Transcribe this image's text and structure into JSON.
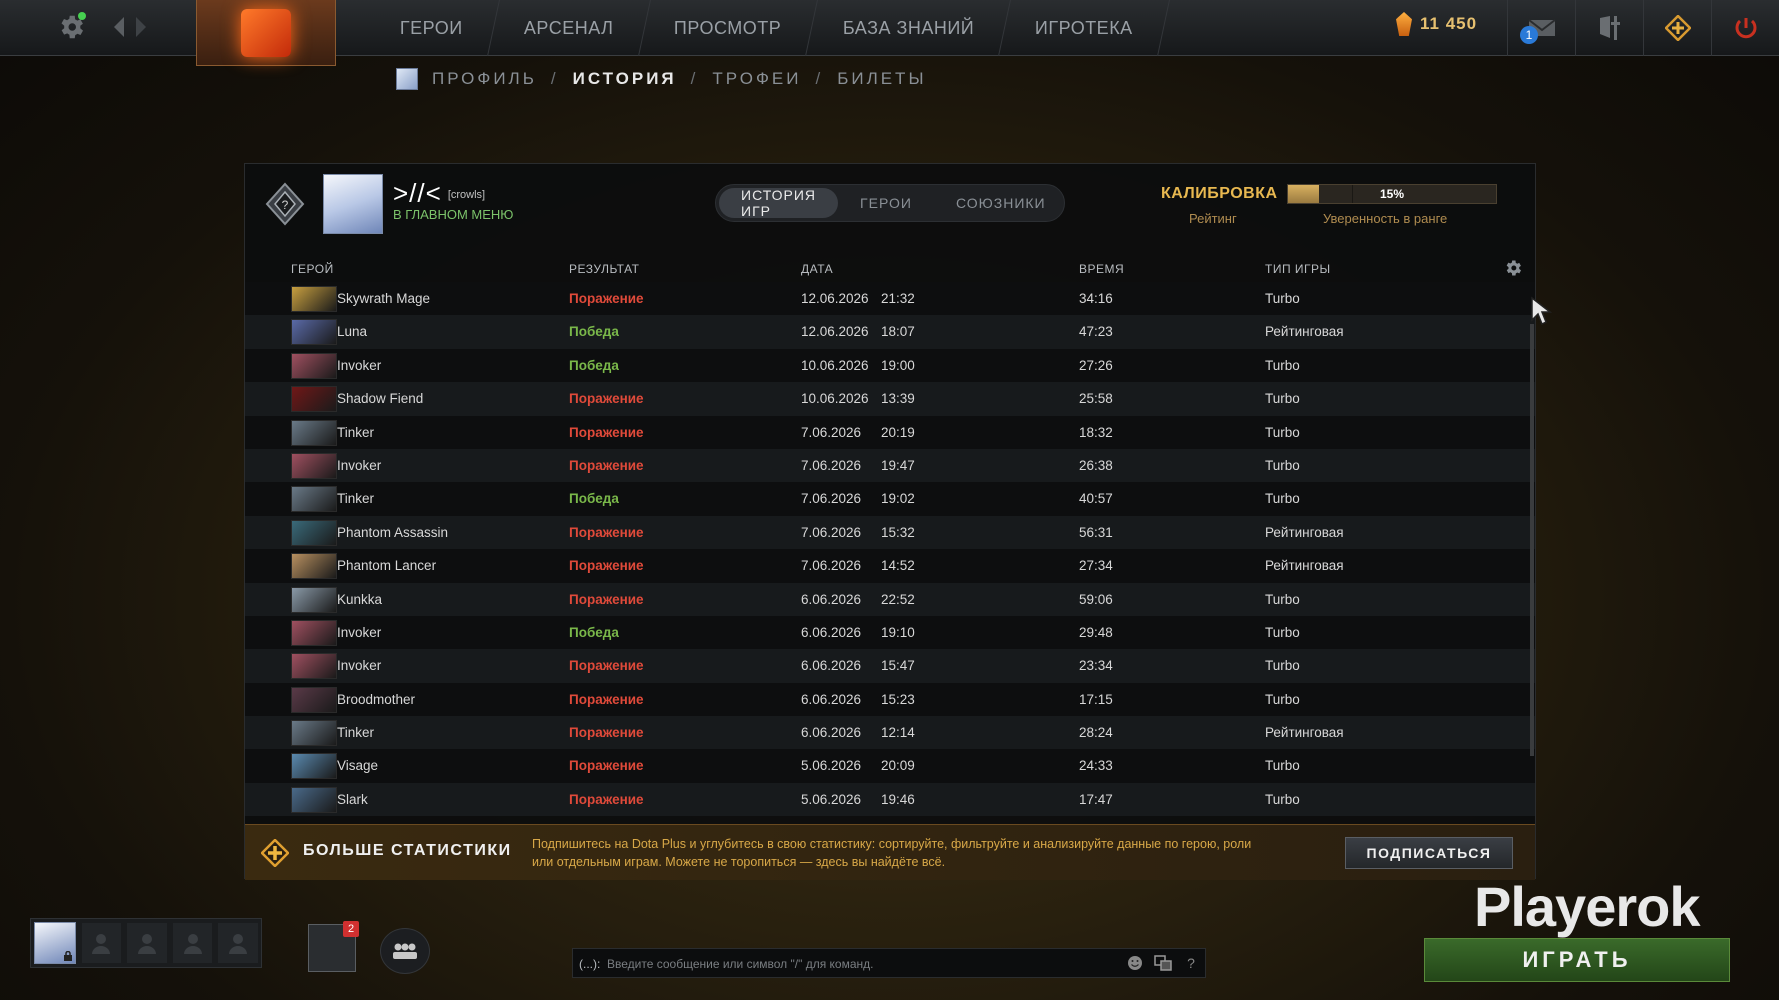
{
  "top_nav": {
    "items": [
      "ГЕРОИ",
      "АРСЕНАЛ",
      "ПРОСМОТР",
      "БАЗА ЗНАНИЙ",
      "ИГРОТЕКА"
    ],
    "currency": "11 450",
    "mail_count": "1"
  },
  "breadcrumb": {
    "profile": "ПРОФИЛЬ",
    "history": "ИСТОРИЯ",
    "trophies": "ТРОФЕИ",
    "tickets": "БИЛЕТЫ",
    "separator": "/"
  },
  "profile": {
    "name": ">//<",
    "tag": "[crowls]",
    "status": "В ГЛАВНОМ МЕНЮ"
  },
  "tabs": {
    "games": "ИСТОРИЯ ИГР",
    "heroes": "ГЕРОИ",
    "allies": "СОЮЗНИКИ"
  },
  "calibration": {
    "label": "КАЛИБРОВКА",
    "rating_label": "Рейтинг",
    "confidence_percent": 15,
    "confidence_text": "15%",
    "confidence_label": "Уверенность в ранге"
  },
  "columns": {
    "hero": "ГЕРОЙ",
    "result": "РЕЗУЛЬТАТ",
    "date": "ДАТА",
    "time": "ВРЕМЯ",
    "mode": "ТИП ИГРЫ"
  },
  "matches": [
    {
      "hero": "Skywrath Mage",
      "result": "Поражение",
      "win": false,
      "date": "12.06.2026",
      "clock": "21:32",
      "duration": "34:16",
      "mode": "Turbo"
    },
    {
      "hero": "Luna",
      "result": "Победа",
      "win": true,
      "date": "12.06.2026",
      "clock": "18:07",
      "duration": "47:23",
      "mode": "Рейтинговая"
    },
    {
      "hero": "Invoker",
      "result": "Победа",
      "win": true,
      "date": "10.06.2026",
      "clock": "19:00",
      "duration": "27:26",
      "mode": "Turbo"
    },
    {
      "hero": "Shadow Fiend",
      "result": "Поражение",
      "win": false,
      "date": "10.06.2026",
      "clock": "13:39",
      "duration": "25:58",
      "mode": "Turbo"
    },
    {
      "hero": "Tinker",
      "result": "Поражение",
      "win": false,
      "date": "7.06.2026",
      "clock": "20:19",
      "duration": "18:32",
      "mode": "Turbo"
    },
    {
      "hero": "Invoker",
      "result": "Поражение",
      "win": false,
      "date": "7.06.2026",
      "clock": "19:47",
      "duration": "26:38",
      "mode": "Turbo"
    },
    {
      "hero": "Tinker",
      "result": "Победа",
      "win": true,
      "date": "7.06.2026",
      "clock": "19:02",
      "duration": "40:57",
      "mode": "Turbo"
    },
    {
      "hero": "Phantom Assassin",
      "result": "Поражение",
      "win": false,
      "date": "7.06.2026",
      "clock": "15:32",
      "duration": "56:31",
      "mode": "Рейтинговая"
    },
    {
      "hero": "Phantom Lancer",
      "result": "Поражение",
      "win": false,
      "date": "7.06.2026",
      "clock": "14:52",
      "duration": "27:34",
      "mode": "Рейтинговая"
    },
    {
      "hero": "Kunkka",
      "result": "Поражение",
      "win": false,
      "date": "6.06.2026",
      "clock": "22:52",
      "duration": "59:06",
      "mode": "Turbo"
    },
    {
      "hero": "Invoker",
      "result": "Победа",
      "win": true,
      "date": "6.06.2026",
      "clock": "19:10",
      "duration": "29:48",
      "mode": "Turbo"
    },
    {
      "hero": "Invoker",
      "result": "Поражение",
      "win": false,
      "date": "6.06.2026",
      "clock": "15:47",
      "duration": "23:34",
      "mode": "Turbo"
    },
    {
      "hero": "Broodmother",
      "result": "Поражение",
      "win": false,
      "date": "6.06.2026",
      "clock": "15:23",
      "duration": "17:15",
      "mode": "Turbo"
    },
    {
      "hero": "Tinker",
      "result": "Поражение",
      "win": false,
      "date": "6.06.2026",
      "clock": "12:14",
      "duration": "28:24",
      "mode": "Рейтинговая"
    },
    {
      "hero": "Visage",
      "result": "Поражение",
      "win": false,
      "date": "5.06.2026",
      "clock": "20:09",
      "duration": "24:33",
      "mode": "Turbo"
    },
    {
      "hero": "Slark",
      "result": "Поражение",
      "win": false,
      "date": "5.06.2026",
      "clock": "19:46",
      "duration": "17:47",
      "mode": "Turbo"
    }
  ],
  "hero_colors": {
    "Skywrath Mage": "#c8a040",
    "Luna": "#5a6aa8",
    "Invoker": "#a05060",
    "Shadow Fiend": "#701818",
    "Tinker": "#6a7a88",
    "Phantom Assassin": "#3a6a7a",
    "Phantom Lancer": "#b89060",
    "Kunkka": "#8a9aa8",
    "Broodmother": "#5a3a48",
    "Visage": "#5a8ab0",
    "Slark": "#4a6a8a"
  },
  "colors": {
    "loss": "#e04a3a",
    "win": "#7ab84a",
    "accent_gold": "#e8b850"
  },
  "plus_banner": {
    "title": "БОЛЬШЕ СТАТИСТИКИ",
    "description": "Подпишитесь на Dota Plus и углубитесь в свою статистику: сортируйте, фильтруйте и анализируйте данные по герою, роли или отдельным играм. Можете не торопиться — здесь вы найдёте всё.",
    "button": "ПОДПИСАТЬСЯ"
  },
  "bottom": {
    "inventory_badge": "2",
    "chat_channel": "(...):",
    "chat_placeholder": "Введите сообщение или символ \"/\" для команд.",
    "chat_help": "?",
    "play_button": "ИГРАТЬ",
    "watermark": "Playerok"
  },
  "icons": {
    "top_left": "gear-icon",
    "nav": "arrow-icons",
    "mail": "mail-icon",
    "armory": "shield-icon",
    "plus": "plus-icon",
    "power": "power-icon"
  }
}
